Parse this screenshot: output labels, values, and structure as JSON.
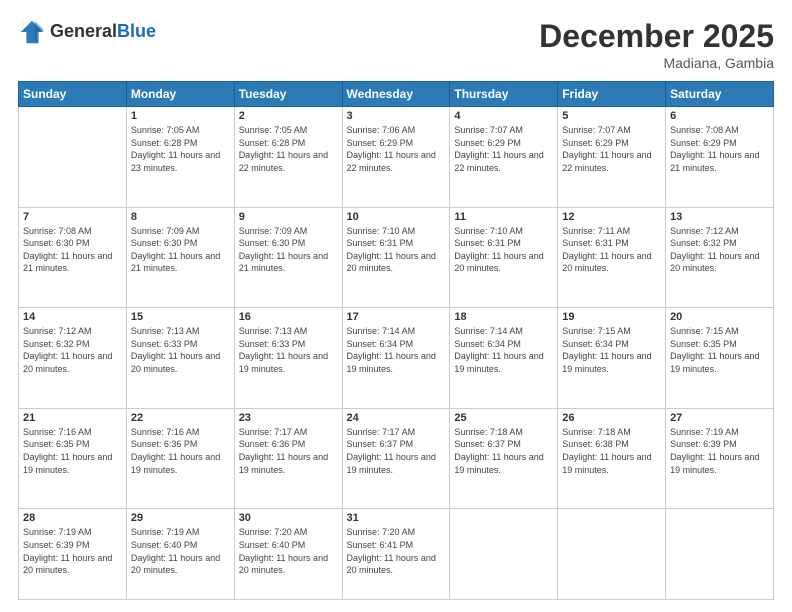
{
  "header": {
    "logo_general": "General",
    "logo_blue": "Blue",
    "month_title": "December 2025",
    "location": "Madiana, Gambia"
  },
  "days_of_week": [
    "Sunday",
    "Monday",
    "Tuesday",
    "Wednesday",
    "Thursday",
    "Friday",
    "Saturday"
  ],
  "weeks": [
    [
      {
        "day": "",
        "sunrise": "",
        "sunset": "",
        "daylight": ""
      },
      {
        "day": "1",
        "sunrise": "Sunrise: 7:05 AM",
        "sunset": "Sunset: 6:28 PM",
        "daylight": "Daylight: 11 hours and 23 minutes."
      },
      {
        "day": "2",
        "sunrise": "Sunrise: 7:05 AM",
        "sunset": "Sunset: 6:28 PM",
        "daylight": "Daylight: 11 hours and 22 minutes."
      },
      {
        "day": "3",
        "sunrise": "Sunrise: 7:06 AM",
        "sunset": "Sunset: 6:29 PM",
        "daylight": "Daylight: 11 hours and 22 minutes."
      },
      {
        "day": "4",
        "sunrise": "Sunrise: 7:07 AM",
        "sunset": "Sunset: 6:29 PM",
        "daylight": "Daylight: 11 hours and 22 minutes."
      },
      {
        "day": "5",
        "sunrise": "Sunrise: 7:07 AM",
        "sunset": "Sunset: 6:29 PM",
        "daylight": "Daylight: 11 hours and 22 minutes."
      },
      {
        "day": "6",
        "sunrise": "Sunrise: 7:08 AM",
        "sunset": "Sunset: 6:29 PM",
        "daylight": "Daylight: 11 hours and 21 minutes."
      }
    ],
    [
      {
        "day": "7",
        "sunrise": "Sunrise: 7:08 AM",
        "sunset": "Sunset: 6:30 PM",
        "daylight": "Daylight: 11 hours and 21 minutes."
      },
      {
        "day": "8",
        "sunrise": "Sunrise: 7:09 AM",
        "sunset": "Sunset: 6:30 PM",
        "daylight": "Daylight: 11 hours and 21 minutes."
      },
      {
        "day": "9",
        "sunrise": "Sunrise: 7:09 AM",
        "sunset": "Sunset: 6:30 PM",
        "daylight": "Daylight: 11 hours and 21 minutes."
      },
      {
        "day": "10",
        "sunrise": "Sunrise: 7:10 AM",
        "sunset": "Sunset: 6:31 PM",
        "daylight": "Daylight: 11 hours and 20 minutes."
      },
      {
        "day": "11",
        "sunrise": "Sunrise: 7:10 AM",
        "sunset": "Sunset: 6:31 PM",
        "daylight": "Daylight: 11 hours and 20 minutes."
      },
      {
        "day": "12",
        "sunrise": "Sunrise: 7:11 AM",
        "sunset": "Sunset: 6:31 PM",
        "daylight": "Daylight: 11 hours and 20 minutes."
      },
      {
        "day": "13",
        "sunrise": "Sunrise: 7:12 AM",
        "sunset": "Sunset: 6:32 PM",
        "daylight": "Daylight: 11 hours and 20 minutes."
      }
    ],
    [
      {
        "day": "14",
        "sunrise": "Sunrise: 7:12 AM",
        "sunset": "Sunset: 6:32 PM",
        "daylight": "Daylight: 11 hours and 20 minutes."
      },
      {
        "day": "15",
        "sunrise": "Sunrise: 7:13 AM",
        "sunset": "Sunset: 6:33 PM",
        "daylight": "Daylight: 11 hours and 20 minutes."
      },
      {
        "day": "16",
        "sunrise": "Sunrise: 7:13 AM",
        "sunset": "Sunset: 6:33 PM",
        "daylight": "Daylight: 11 hours and 19 minutes."
      },
      {
        "day": "17",
        "sunrise": "Sunrise: 7:14 AM",
        "sunset": "Sunset: 6:34 PM",
        "daylight": "Daylight: 11 hours and 19 minutes."
      },
      {
        "day": "18",
        "sunrise": "Sunrise: 7:14 AM",
        "sunset": "Sunset: 6:34 PM",
        "daylight": "Daylight: 11 hours and 19 minutes."
      },
      {
        "day": "19",
        "sunrise": "Sunrise: 7:15 AM",
        "sunset": "Sunset: 6:34 PM",
        "daylight": "Daylight: 11 hours and 19 minutes."
      },
      {
        "day": "20",
        "sunrise": "Sunrise: 7:15 AM",
        "sunset": "Sunset: 6:35 PM",
        "daylight": "Daylight: 11 hours and 19 minutes."
      }
    ],
    [
      {
        "day": "21",
        "sunrise": "Sunrise: 7:16 AM",
        "sunset": "Sunset: 6:35 PM",
        "daylight": "Daylight: 11 hours and 19 minutes."
      },
      {
        "day": "22",
        "sunrise": "Sunrise: 7:16 AM",
        "sunset": "Sunset: 6:36 PM",
        "daylight": "Daylight: 11 hours and 19 minutes."
      },
      {
        "day": "23",
        "sunrise": "Sunrise: 7:17 AM",
        "sunset": "Sunset: 6:36 PM",
        "daylight": "Daylight: 11 hours and 19 minutes."
      },
      {
        "day": "24",
        "sunrise": "Sunrise: 7:17 AM",
        "sunset": "Sunset: 6:37 PM",
        "daylight": "Daylight: 11 hours and 19 minutes."
      },
      {
        "day": "25",
        "sunrise": "Sunrise: 7:18 AM",
        "sunset": "Sunset: 6:37 PM",
        "daylight": "Daylight: 11 hours and 19 minutes."
      },
      {
        "day": "26",
        "sunrise": "Sunrise: 7:18 AM",
        "sunset": "Sunset: 6:38 PM",
        "daylight": "Daylight: 11 hours and 19 minutes."
      },
      {
        "day": "27",
        "sunrise": "Sunrise: 7:19 AM",
        "sunset": "Sunset: 6:39 PM",
        "daylight": "Daylight: 11 hours and 19 minutes."
      }
    ],
    [
      {
        "day": "28",
        "sunrise": "Sunrise: 7:19 AM",
        "sunset": "Sunset: 6:39 PM",
        "daylight": "Daylight: 11 hours and 20 minutes."
      },
      {
        "day": "29",
        "sunrise": "Sunrise: 7:19 AM",
        "sunset": "Sunset: 6:40 PM",
        "daylight": "Daylight: 11 hours and 20 minutes."
      },
      {
        "day": "30",
        "sunrise": "Sunrise: 7:20 AM",
        "sunset": "Sunset: 6:40 PM",
        "daylight": "Daylight: 11 hours and 20 minutes."
      },
      {
        "day": "31",
        "sunrise": "Sunrise: 7:20 AM",
        "sunset": "Sunset: 6:41 PM",
        "daylight": "Daylight: 11 hours and 20 minutes."
      },
      {
        "day": "",
        "sunrise": "",
        "sunset": "",
        "daylight": ""
      },
      {
        "day": "",
        "sunrise": "",
        "sunset": "",
        "daylight": ""
      },
      {
        "day": "",
        "sunrise": "",
        "sunset": "",
        "daylight": ""
      }
    ]
  ]
}
